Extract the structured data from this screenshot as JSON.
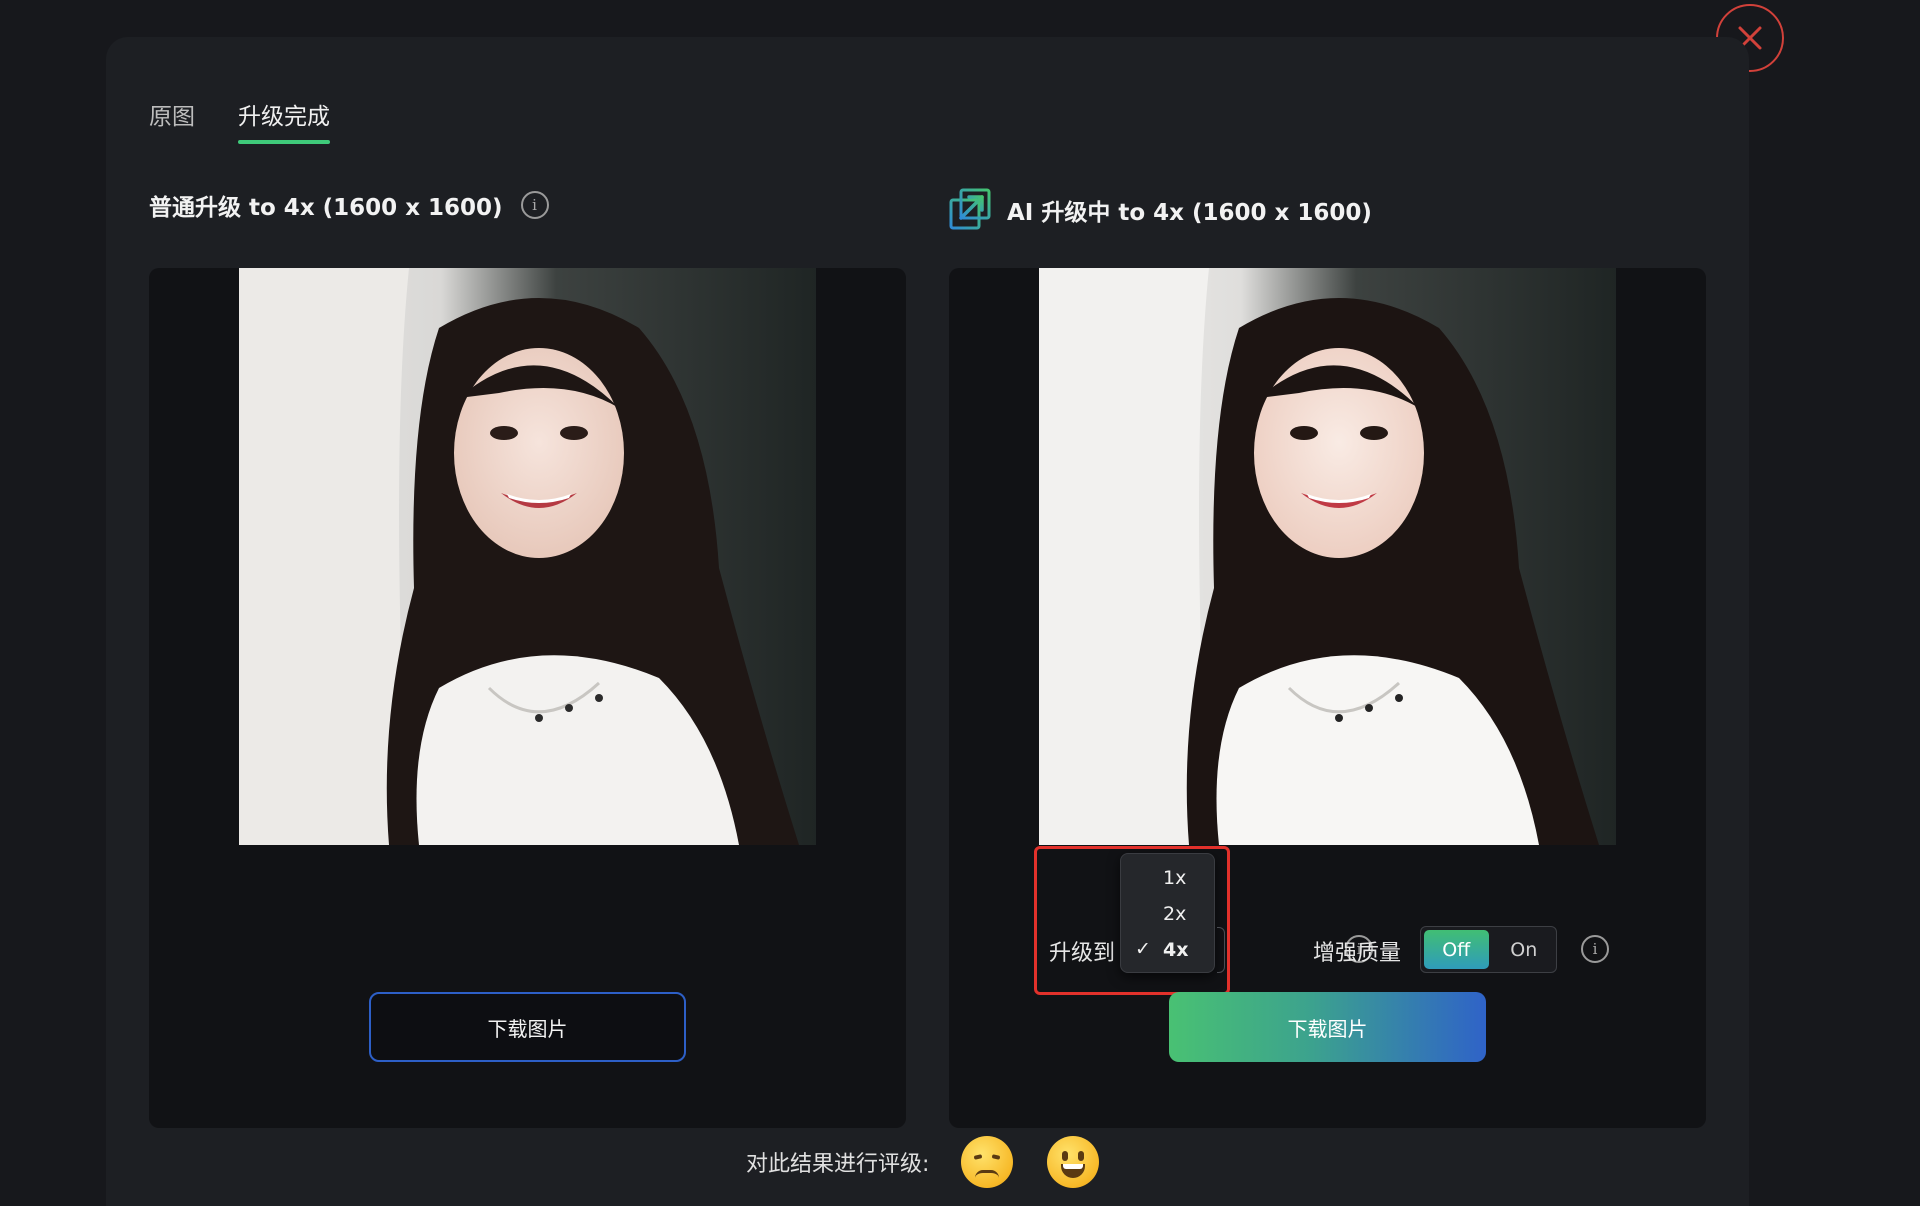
{
  "tabs": [
    {
      "label": "原图"
    },
    {
      "label": "升级完成"
    }
  ],
  "left": {
    "title": "普通升级 to 4x (1600 x 1600)",
    "download_label": "下载图片"
  },
  "right": {
    "title": "AI 升级中 to 4x (1600 x 1600)",
    "upgrade_label": "升级到",
    "scale_options": [
      "1x",
      "2x",
      "4x"
    ],
    "selected_scale": "4x",
    "enhance_label": "增强质量",
    "toggle_off": "Off",
    "toggle_on": "On",
    "toggle_state": "Off",
    "download_label": "下载图片"
  },
  "rating": {
    "label": "对此结果进行评级:"
  },
  "icons": {
    "close": "close-icon",
    "info": "info-icon",
    "ai_upscale": "upscale-arrow-icon",
    "sad": "sad-face-emoji",
    "happy": "grinning-face-emoji"
  },
  "colors": {
    "accent_green": "#3fca7a",
    "close_red": "#d2413a",
    "highlight_red": "#e2312b",
    "button_blue": "#2f63c8"
  }
}
